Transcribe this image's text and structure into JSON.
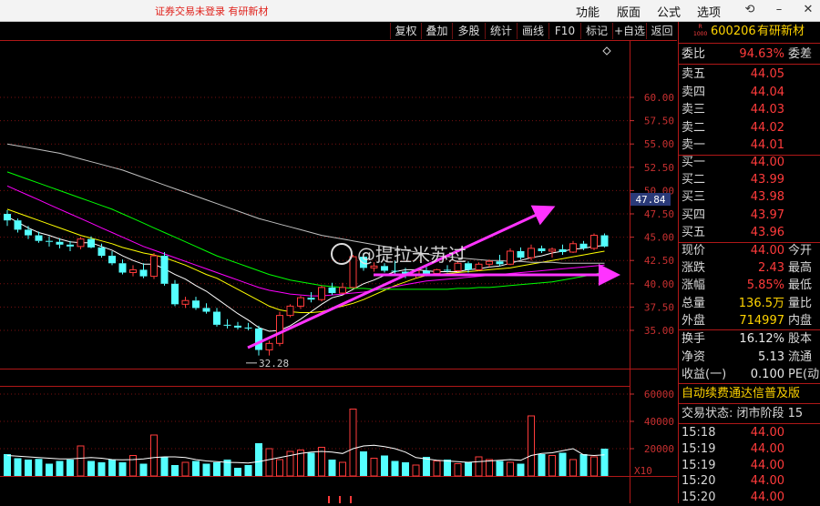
{
  "topbar": {
    "warning": "证券交易未登录   有研新材",
    "menu": [
      "功能",
      "版面",
      "公式",
      "选项"
    ],
    "icons": [
      "restore-icon",
      "minimize-icon",
      "close-icon"
    ]
  },
  "toolbar": {
    "buttons": [
      "复权",
      "叠加",
      "多股",
      "统计",
      "画线",
      "F10",
      "标记",
      "+自选",
      "返回"
    ]
  },
  "stock": {
    "code": "600206",
    "name": "有研新材",
    "badge_top": "R",
    "badge_bottom": "1000"
  },
  "quote": {
    "weibi_label": "委比",
    "weibi_value": "94.63%",
    "weicha_label": "委差",
    "asks": [
      {
        "label": "卖五",
        "price": "44.05"
      },
      {
        "label": "卖四",
        "price": "44.04"
      },
      {
        "label": "卖三",
        "price": "44.03"
      },
      {
        "label": "卖二",
        "price": "44.02"
      },
      {
        "label": "卖一",
        "price": "44.01"
      }
    ],
    "bids": [
      {
        "label": "买一",
        "price": "44.00"
      },
      {
        "label": "买二",
        "price": "43.99"
      },
      {
        "label": "买三",
        "price": "43.98"
      },
      {
        "label": "买四",
        "price": "43.97"
      },
      {
        "label": "买五",
        "price": "43.96"
      }
    ],
    "stats": [
      {
        "label": "现价",
        "value": "44.00",
        "label2": "今开"
      },
      {
        "label": "涨跌",
        "value": "2.43",
        "label2": "最高"
      },
      {
        "label": "涨幅",
        "value": "5.85%",
        "label2": "最低"
      },
      {
        "label": "总量",
        "value": "136.5万",
        "label2": "量比"
      },
      {
        "label": "外盘",
        "value": "714997",
        "label2": "内盘"
      }
    ],
    "stats2": [
      {
        "label": "换手",
        "value": "16.12%",
        "label2": "股本"
      },
      {
        "label": "净资",
        "value": "5.13",
        "label2": "流通"
      },
      {
        "label": "收益(一)",
        "value": "0.100",
        "label2": "PE(动"
      }
    ],
    "ticker": "自动续费通达信普及版",
    "status": "交易状态: 闭市阶段 15",
    "ticks": [
      {
        "time": "15:18",
        "price": "44.00"
      },
      {
        "time": "15:19",
        "price": "44.00"
      },
      {
        "time": "15:19",
        "price": "44.00"
      },
      {
        "time": "15:20",
        "price": "44.00"
      },
      {
        "time": "15:20",
        "price": "44.00"
      }
    ]
  },
  "chart": {
    "y_ticks": [
      "60.00",
      "57.50",
      "55.00",
      "52.50",
      "50.00",
      "47.50",
      "45.00",
      "42.50",
      "40.00",
      "37.50",
      "35.00"
    ],
    "current_price_tag": "47.84",
    "low_marker": "32.28",
    "vol_ticks": [
      "60000",
      "40000",
      "20000"
    ],
    "vol_unit": "X10",
    "watermark": "@提拉米苏过",
    "colors": {
      "up": "#ff3b3b",
      "down": "#54ffff",
      "ma5": "#ffffff",
      "ma10": "#ffff00",
      "ma20": "#ff00ff",
      "ma60": "#00ff00",
      "ma120": "#c0c0c0",
      "arrow": "#ff33ff"
    }
  },
  "chart_data": {
    "type": "candlestick",
    "price_range": [
      32.0,
      62.5
    ],
    "candles": [
      [
        47.5,
        47.9,
        46.2,
        46.8
      ],
      [
        46.8,
        47.0,
        45.5,
        45.8
      ],
      [
        45.8,
        46.2,
        44.8,
        45.2
      ],
      [
        45.2,
        45.6,
        44.4,
        44.6
      ],
      [
        44.6,
        45.1,
        44.0,
        44.5
      ],
      [
        44.5,
        44.9,
        43.8,
        44.2
      ],
      [
        44.2,
        44.6,
        43.5,
        44.0
      ],
      [
        44.0,
        45.0,
        43.7,
        44.8
      ],
      [
        44.8,
        45.1,
        43.8,
        43.9
      ],
      [
        43.9,
        44.3,
        42.8,
        43.0
      ],
      [
        43.0,
        43.5,
        42.0,
        42.2
      ],
      [
        42.2,
        42.6,
        41.0,
        41.2
      ],
      [
        41.2,
        42.0,
        40.8,
        41.5
      ],
      [
        41.5,
        42.2,
        40.6,
        40.8
      ],
      [
        40.8,
        43.3,
        40.5,
        43.0
      ],
      [
        43.0,
        43.4,
        39.8,
        40.0
      ],
      [
        40.0,
        40.4,
        37.6,
        37.8
      ],
      [
        37.8,
        38.6,
        37.4,
        38.2
      ],
      [
        38.2,
        38.6,
        37.2,
        37.4
      ],
      [
        37.4,
        37.9,
        36.8,
        37.0
      ],
      [
        37.0,
        37.4,
        35.4,
        35.6
      ],
      [
        35.6,
        36.2,
        35.2,
        35.5
      ],
      [
        35.5,
        35.9,
        35.1,
        35.3
      ],
      [
        35.3,
        35.8,
        35.0,
        35.2
      ],
      [
        35.2,
        35.5,
        32.3,
        32.9
      ],
      [
        32.9,
        33.9,
        32.3,
        33.6
      ],
      [
        33.6,
        37.0,
        33.3,
        36.6
      ],
      [
        36.6,
        37.8,
        36.4,
        37.6
      ],
      [
        37.6,
        38.7,
        37.3,
        38.5
      ],
      [
        38.5,
        39.1,
        38.0,
        38.3
      ],
      [
        38.3,
        39.8,
        38.1,
        39.6
      ],
      [
        39.6,
        40.1,
        38.8,
        39.0
      ],
      [
        39.0,
        40.1,
        38.9,
        39.6
      ],
      [
        39.6,
        43.1,
        39.5,
        42.9
      ],
      [
        42.9,
        43.3,
        41.4,
        41.7
      ],
      [
        41.7,
        42.3,
        41.3,
        41.9
      ],
      [
        41.9,
        42.2,
        41.2,
        41.4
      ],
      [
        41.4,
        42.5,
        41.1,
        41.3
      ],
      [
        41.3,
        41.7,
        40.6,
        40.9
      ],
      [
        40.9,
        41.6,
        40.6,
        41.4
      ],
      [
        41.4,
        41.8,
        40.8,
        41.1
      ],
      [
        41.1,
        41.6,
        40.9,
        41.5
      ],
      [
        41.5,
        42.0,
        41.2,
        41.4
      ],
      [
        41.4,
        42.5,
        41.3,
        42.2
      ],
      [
        42.2,
        42.4,
        41.2,
        41.5
      ],
      [
        41.5,
        42.3,
        41.4,
        42.1
      ],
      [
        42.1,
        42.6,
        41.8,
        42.4
      ],
      [
        42.4,
        43.1,
        41.9,
        42.1
      ],
      [
        42.1,
        43.8,
        42.0,
        43.5
      ],
      [
        43.5,
        43.9,
        42.6,
        42.8
      ],
      [
        42.8,
        44.2,
        42.5,
        43.8
      ],
      [
        43.8,
        44.1,
        43.3,
        43.5
      ],
      [
        43.5,
        43.9,
        42.8,
        43.7
      ],
      [
        43.7,
        44.2,
        43.1,
        43.4
      ],
      [
        43.4,
        44.6,
        43.3,
        44.3
      ],
      [
        44.3,
        44.6,
        43.6,
        43.8
      ],
      [
        43.8,
        45.4,
        43.6,
        45.2
      ],
      [
        45.2,
        45.4,
        43.9,
        44.0
      ]
    ],
    "ma_series": [
      {
        "key": "ma5",
        "values": [
          47.2,
          46.6,
          46.0,
          45.5,
          45.2,
          44.8,
          44.5,
          44.4,
          44.4,
          44.0,
          43.6,
          43.0,
          42.5,
          42.1,
          42.1,
          41.6,
          41.0,
          40.5,
          39.8,
          39.2,
          38.4,
          37.6,
          36.8,
          36.1,
          35.3,
          34.9,
          35.0,
          35.5,
          36.2,
          37.0,
          37.8,
          38.5,
          38.8,
          39.4,
          40.0,
          40.4,
          40.9,
          41.3,
          41.5,
          41.5,
          41.4,
          41.3,
          41.3,
          41.3,
          41.5,
          41.6,
          41.8,
          41.9,
          42.2,
          42.5,
          42.8,
          43.0,
          43.3,
          43.5,
          43.7,
          43.8,
          44.0,
          44.1
        ]
      },
      {
        "key": "ma10",
        "values": [
          48.0,
          47.6,
          47.2,
          46.8,
          46.4,
          46.0,
          45.6,
          45.2,
          44.9,
          44.6,
          44.3,
          43.9,
          43.6,
          43.3,
          43.1,
          42.8,
          42.4,
          42.0,
          41.5,
          41.0,
          40.6,
          40.0,
          39.4,
          38.8,
          38.2,
          37.6,
          37.2,
          37.0,
          36.9,
          36.9,
          37.0,
          37.3,
          37.6,
          37.9,
          38.3,
          38.8,
          39.3,
          39.8,
          40.2,
          40.6,
          40.9,
          41.0,
          41.1,
          41.2,
          41.3,
          41.4,
          41.5,
          41.6,
          41.7,
          41.9,
          42.1,
          42.3,
          42.5,
          42.7,
          42.9,
          43.1,
          43.3,
          43.5
        ]
      },
      {
        "key": "ma20",
        "values": [
          50.5,
          50.0,
          49.5,
          49.0,
          48.5,
          48.0,
          47.5,
          47.0,
          46.5,
          46.0,
          45.5,
          45.0,
          44.5,
          44.0,
          43.6,
          43.2,
          42.8,
          42.4,
          42.0,
          41.6,
          41.2,
          40.8,
          40.4,
          40.0,
          39.6,
          39.3,
          39.1,
          38.9,
          38.8,
          38.7,
          38.7,
          38.8,
          38.9,
          39.0,
          39.1,
          39.3,
          39.5,
          39.7,
          39.9,
          40.1,
          40.3,
          40.4,
          40.5,
          40.6,
          40.7,
          40.8,
          40.9,
          41.0,
          41.1,
          41.2,
          41.3,
          41.4,
          41.5,
          41.6,
          41.7,
          41.8,
          41.9,
          42.0
        ]
      },
      {
        "key": "ma60",
        "values": [
          52.0,
          51.6,
          51.2,
          50.8,
          50.4,
          50.0,
          49.6,
          49.2,
          48.8,
          48.4,
          48.0,
          47.5,
          47.0,
          46.5,
          46.0,
          45.5,
          45.0,
          44.5,
          44.0,
          43.5,
          43.0,
          42.6,
          42.2,
          41.8,
          41.4,
          41.0,
          40.7,
          40.4,
          40.2,
          40.0,
          39.8,
          39.7,
          39.6,
          39.5,
          39.5,
          39.4,
          39.4,
          39.4,
          39.4,
          39.4,
          39.4,
          39.4,
          39.4,
          39.5,
          39.5,
          39.6,
          39.6,
          39.7,
          39.8,
          39.9,
          40.0,
          40.1,
          40.2,
          40.4,
          40.6,
          40.8,
          41.0,
          41.3
        ]
      },
      {
        "key": "ma120",
        "values": [
          55.0,
          54.8,
          54.6,
          54.4,
          54.2,
          54.0,
          53.7,
          53.4,
          53.1,
          52.8,
          52.5,
          52.2,
          51.8,
          51.4,
          51.0,
          50.6,
          50.2,
          49.8,
          49.4,
          49.0,
          48.6,
          48.2,
          47.8,
          47.4,
          47.0,
          46.7,
          46.4,
          46.1,
          45.8,
          45.5,
          45.2,
          45.0,
          44.8,
          44.6,
          44.4,
          44.2,
          44.0,
          43.8,
          43.6,
          43.4,
          43.2,
          43.0,
          42.9,
          42.8,
          42.7,
          42.6,
          42.5,
          42.5,
          42.4,
          42.4,
          42.3,
          42.3,
          42.3,
          42.2,
          42.2,
          42.2,
          42.2,
          42.2
        ]
      }
    ],
    "volume": [
      16000,
      13000,
      12000,
      12500,
      9000,
      11000,
      12000,
      22000,
      11000,
      10000,
      12000,
      10000,
      15000,
      9000,
      30000,
      14000,
      8000,
      10000,
      11000,
      9000,
      10000,
      12000,
      6000,
      8000,
      24000,
      20000,
      12000,
      18000,
      19000,
      17000,
      21000,
      12000,
      10000,
      49000,
      18000,
      13000,
      15000,
      11000,
      10000,
      8000,
      14000,
      11000,
      12000,
      9000,
      10000,
      14000,
      12000,
      11000,
      10000,
      9000,
      44000,
      16000,
      15000,
      17000,
      12000,
      16000,
      14000,
      20000
    ],
    "volume_ma": [
      15000,
      14500,
      14000,
      13500,
      13000,
      12500,
      12500,
      13000,
      13500,
      13000,
      12000,
      11800,
      12000,
      12500,
      13500,
      14000,
      14000,
      13500,
      12000,
      11000,
      10500,
      10000,
      9800,
      9500,
      10500,
      12000,
      13500,
      15000,
      16500,
      17500,
      18000,
      17500,
      16500,
      20000,
      22000,
      22500,
      21500,
      20000,
      17500,
      13500,
      12500,
      11500,
      11000,
      10500,
      10000,
      10500,
      11000,
      11500,
      12000,
      11500,
      15000,
      16500,
      17000,
      18500,
      20000,
      15500,
      15000,
      15500
    ]
  }
}
